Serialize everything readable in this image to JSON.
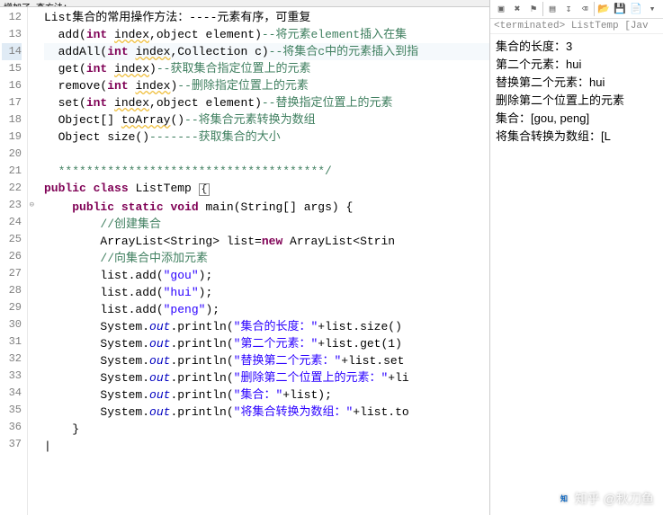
{
  "tabs": {
    "partial": "增加了   查方法："
  },
  "code": {
    "lines": [
      {
        "n": 12,
        "html": "List集合的常用操作方法：----元素有序，可重复"
      },
      {
        "n": 13,
        "html": "  add(<kw>int</kw> <err>index</err>,object element)<cmt>--将元素element插入在集</cmt>"
      },
      {
        "n": 14,
        "hl": true,
        "html": "  addAll(<kw>int</kw> <err>index</err>,Collection c)<cmt>--将集合c中的元素插入到指</cmt>"
      },
      {
        "n": 15,
        "html": "  get(<kw>int</kw> <err>index</err>)<cmt>--获取集合指定位置上的元素</cmt>"
      },
      {
        "n": 16,
        "html": "  remove(<kw>int</kw> <err>index</err>)<cmt>--删除指定位置上的元素</cmt>"
      },
      {
        "n": 17,
        "html": "  set(<kw>int</kw> <err>index</err>,object element)<cmt>--替换指定位置上的元素</cmt>"
      },
      {
        "n": 18,
        "html": "  Object[] <err>toArray</err>()<cmt>--将集合元素转换为数组</cmt>"
      },
      {
        "n": 19,
        "html": "  Object size()<cmt>-------获取集合的大小</cmt>"
      },
      {
        "n": 20,
        "html": ""
      },
      {
        "n": 21,
        "html": "  <cmt>**************************************/</cmt>"
      },
      {
        "n": 22,
        "html": "<kw>public</kw> <kw>class</kw> ListTemp <box>{</box>"
      },
      {
        "n": 23,
        "fold": true,
        "html": "    <kw>public</kw> <kw>static</kw> <kw>void</kw> main(String[] args) {"
      },
      {
        "n": 24,
        "html": "        <cmt>//创建集合</cmt>"
      },
      {
        "n": 25,
        "html": "        ArrayList&lt;String&gt; list=<kw>new</kw> ArrayList&lt;Strin"
      },
      {
        "n": 26,
        "html": "        <cmt>//向集合中添加元素</cmt>"
      },
      {
        "n": 27,
        "html": "        list.add(<str>\"gou\"</str>);"
      },
      {
        "n": 28,
        "html": "        list.add(<str>\"hui\"</str>);"
      },
      {
        "n": 29,
        "html": "        list.add(<str>\"peng\"</str>);"
      },
      {
        "n": 30,
        "html": "        System.<it>out</it>.println(<str>\"集合的长度：\"</str>+list.size()"
      },
      {
        "n": 31,
        "html": "        System.<it>out</it>.println(<str>\"第二个元素：\"</str>+list.get(1)"
      },
      {
        "n": 32,
        "html": "        System.<it>out</it>.println(<str>\"替换第二个元素：\"</str>+list.set"
      },
      {
        "n": 33,
        "html": "        System.<it>out</it>.println(<str>\"删除第二个位置上的元素：\"</str>+li"
      },
      {
        "n": 34,
        "html": "        System.<it>out</it>.println(<str>\"集合：\"</str>+list);"
      },
      {
        "n": 35,
        "html": "        System.<it>out</it>.println(<str>\"将集合转换为数组：\"</str>+list.to"
      },
      {
        "n": 36,
        "html": "    }"
      },
      {
        "n": 37,
        "html": "|"
      }
    ]
  },
  "toolbar": {
    "icons": [
      "remove-all-icon",
      "close-icon",
      "pin-icon",
      "sep",
      "display-icon",
      "scroll-icon",
      "clear-icon",
      "sep",
      "open-icon",
      "save-icon",
      "new-icon",
      "menu-icon"
    ]
  },
  "console": {
    "header": "<terminated> ListTemp [Jav",
    "lines": [
      "集合的长度：3",
      "第二个元素：hui",
      "替换第二个元素：hui",
      "删除第二个位置上的元素",
      "集合：[gou, peng]",
      "将集合转换为数组：[L"
    ]
  },
  "watermark": "知乎 @秋刀鱼"
}
